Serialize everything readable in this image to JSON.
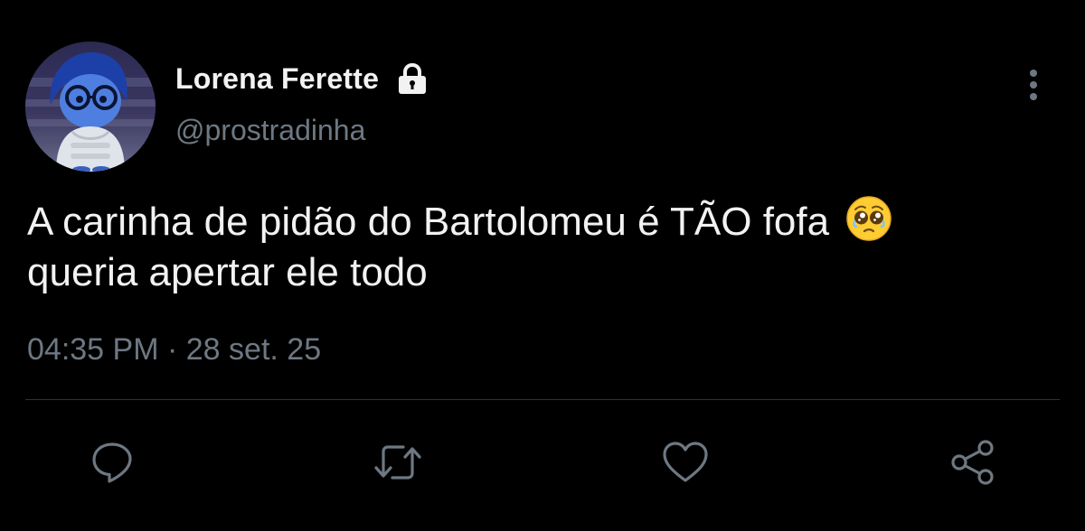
{
  "tweet": {
    "author": {
      "display_name": "Lorena Ferette",
      "handle": "@prostradinha",
      "protected_icon": "lock-icon"
    },
    "text_line_1": "A carinha de pidão do Bartolomeu é TÃO fofa",
    "text_emoji": "🥹",
    "text_line_2": "queria apertar ele todo",
    "time": "04:35 PM",
    "separator": "·",
    "date": "28 set. 25",
    "actions": [
      "reply-icon",
      "retweet-icon",
      "like-icon",
      "share-icon"
    ]
  },
  "colors": {
    "background": "#000000",
    "primary_text": "#f2f2f2",
    "secondary_text": "#6e7882",
    "divider": "#2f3336"
  }
}
